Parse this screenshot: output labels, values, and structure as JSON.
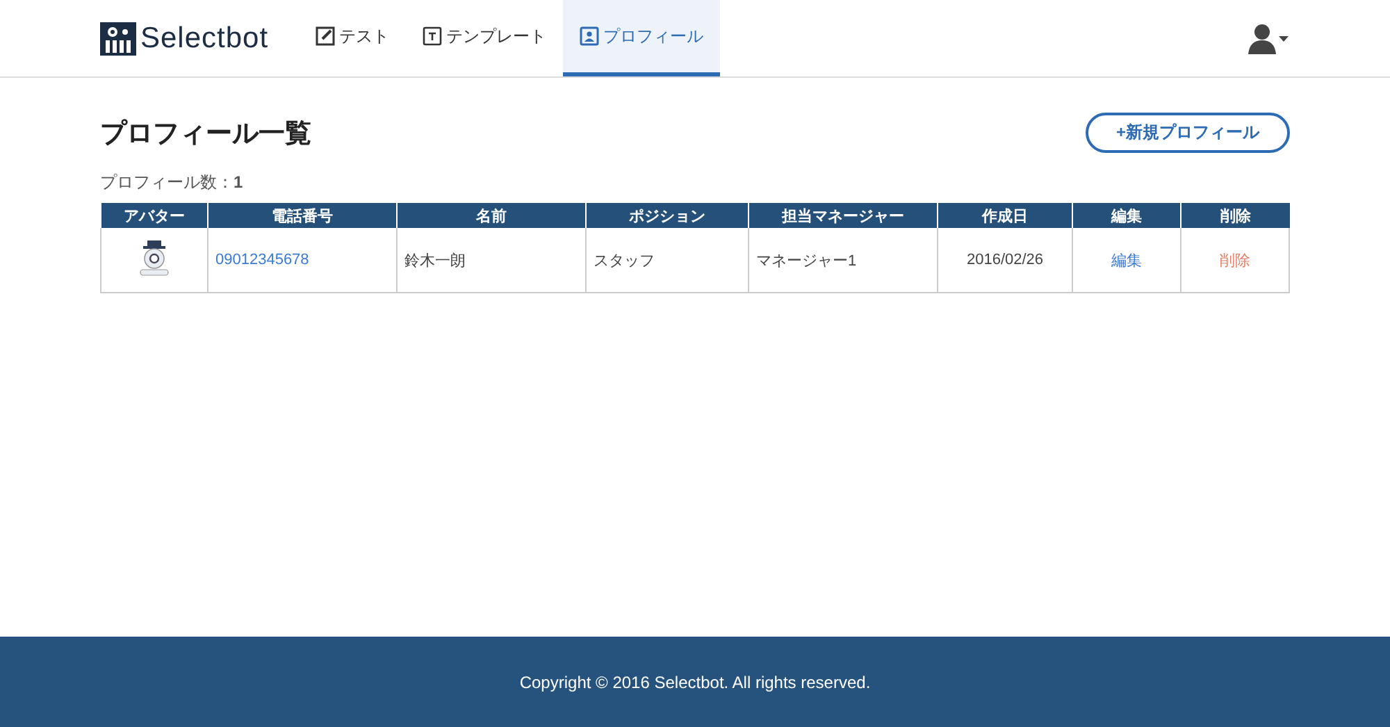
{
  "brand": "Selectbot",
  "nav": [
    {
      "label": "テスト",
      "selected": false
    },
    {
      "label": "テンプレート",
      "selected": false
    },
    {
      "label": "プロフィール",
      "selected": true
    }
  ],
  "page_title": "プロフィール一覧",
  "new_button": "+新規プロフィール",
  "count_text": "プロフィール数：**1**",
  "table": {
    "columns": [
      "アバター",
      "電話番号",
      "名前",
      "ポジション",
      "担当マネージャー",
      "作成日",
      "編集",
      "削除"
    ],
    "rows": [
      {
        "phone": "09012345678",
        "name": "鈴木一朗",
        "position": "スタッフ",
        "manager": "マネージャー1",
        "created": "2016/02/26",
        "edit": "編集",
        "delete": "削除"
      }
    ]
  },
  "footer": "Copyright © 2016 Selectbot. All rights reserved."
}
